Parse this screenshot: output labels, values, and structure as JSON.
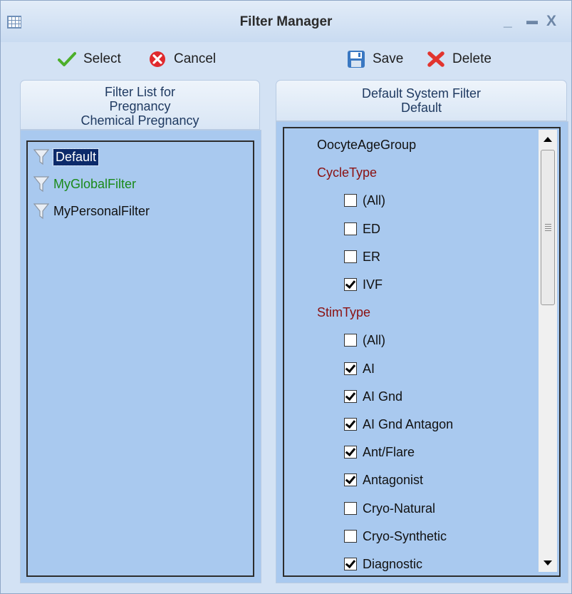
{
  "window": {
    "title": "Filter Manager",
    "minimize": "_",
    "maximize": "▬",
    "close": "X"
  },
  "toolbar": {
    "select_label": "Select",
    "cancel_label": "Cancel",
    "save_label": "Save",
    "delete_label": "Delete"
  },
  "left_panel": {
    "header_lines": [
      "Filter List for",
      "Pregnancy",
      "Chemical Pregnancy"
    ],
    "items": [
      {
        "label": "Default",
        "selected": true,
        "color": "#ffffff"
      },
      {
        "label": "MyGlobalFilter",
        "selected": false,
        "color": "#1a8a1a"
      },
      {
        "label": "MyPersonalFilter",
        "selected": false,
        "color": "#111111"
      }
    ]
  },
  "right_panel": {
    "header_lines": [
      "Default System Filter",
      "Default"
    ],
    "rows": [
      {
        "kind": "plain",
        "label": "OocyteAgeGroup"
      },
      {
        "kind": "group",
        "label": "CycleType"
      },
      {
        "kind": "check",
        "label": "(All)",
        "checked": false
      },
      {
        "kind": "check",
        "label": "ED",
        "checked": false
      },
      {
        "kind": "check",
        "label": "ER",
        "checked": false
      },
      {
        "kind": "check",
        "label": "IVF",
        "checked": true
      },
      {
        "kind": "group",
        "label": "StimType"
      },
      {
        "kind": "check",
        "label": "(All)",
        "checked": false
      },
      {
        "kind": "check",
        "label": "AI",
        "checked": true
      },
      {
        "kind": "check",
        "label": "AI Gnd",
        "checked": true
      },
      {
        "kind": "check",
        "label": "AI Gnd Antagon",
        "checked": true
      },
      {
        "kind": "check",
        "label": "Ant/Flare",
        "checked": true
      },
      {
        "kind": "check",
        "label": "Antagonist",
        "checked": true
      },
      {
        "kind": "check",
        "label": "Cryo-Natural",
        "checked": false
      },
      {
        "kind": "check",
        "label": "Cryo-Synthetic",
        "checked": false
      },
      {
        "kind": "check",
        "label": "Diagnostic",
        "checked": true
      }
    ]
  },
  "icons": {
    "select": "checkmark-icon",
    "cancel": "cancel-icon",
    "save": "save-icon",
    "delete": "delete-icon",
    "filter": "funnel-icon"
  },
  "colors": {
    "list_bg": "#a9c9ef",
    "selected_bg": "#0c2a6a",
    "group_text": "#8b1010",
    "window_bg": "#d3e2f4"
  }
}
